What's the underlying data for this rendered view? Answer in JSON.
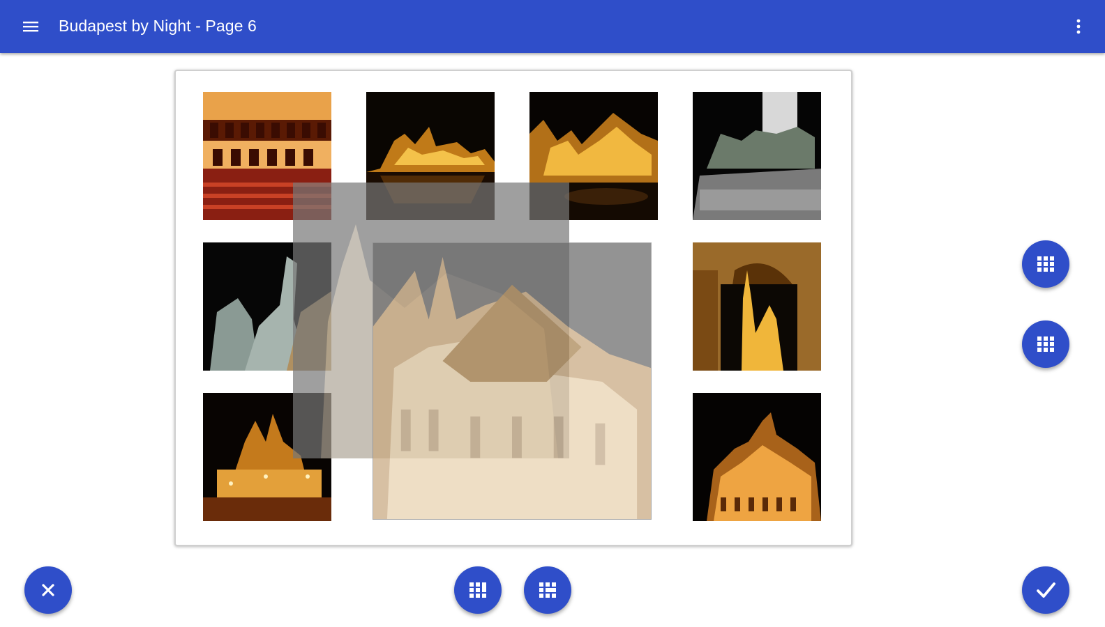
{
  "appbar": {
    "title": "Budapest by Night - Page 6",
    "menu_icon": "hamburger-menu-icon",
    "overflow_icon": "more-vert-icon",
    "color": "#2f4ec9"
  },
  "page": {
    "photos": [
      {
        "name": "opera-house-interior"
      },
      {
        "name": "vajdahunyad-castle-night"
      },
      {
        "name": "palace-lit-night"
      },
      {
        "name": "heroes-square-statues"
      },
      {
        "name": "horse-statues-night"
      },
      {
        "name": "arcade-cathedral-view"
      },
      {
        "name": "fishermans-bastion-tower"
      },
      {
        "name": "matthias-church-night"
      }
    ],
    "dragging_photo": "matthias-church-large"
  },
  "fabs": {
    "cancel_icon": "close-icon",
    "confirm_icon": "check-icon",
    "layout_icons": [
      "grid-layout-icon",
      "grid-layout-icon",
      "grid-layout-icon",
      "grid-layout-icon"
    ]
  }
}
